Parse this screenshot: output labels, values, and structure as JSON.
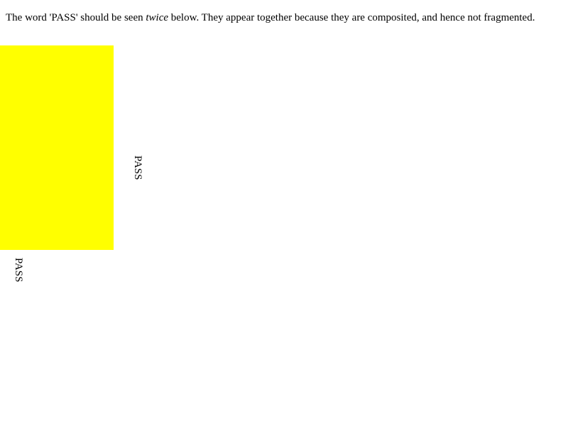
{
  "instructions": {
    "prefix": "The word 'PASS' should be seen ",
    "emphasis": "twice",
    "suffix": " below. They appear together because they are composited, and hence not fragmented."
  },
  "block": {
    "color": "#ffff00"
  },
  "markers": [
    {
      "text": "PASS"
    },
    {
      "text": "PASS"
    }
  ]
}
